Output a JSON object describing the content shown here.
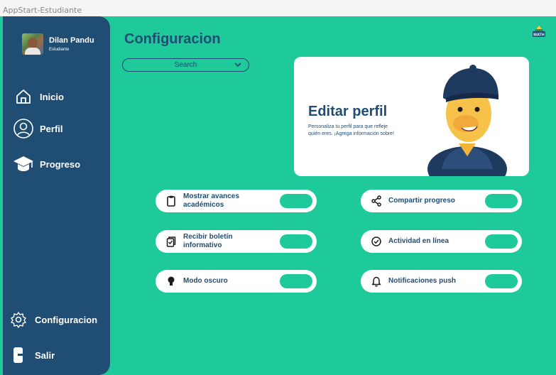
{
  "window": {
    "title": "AppStart-Estudiante"
  },
  "profile": {
    "name": "Dilan Pandu",
    "role": "Estudiante"
  },
  "sidebar": {
    "items": [
      {
        "label": "Inicio",
        "icon": "home-icon"
      },
      {
        "label": "Perfil",
        "icon": "user-icon"
      },
      {
        "label": "Progreso",
        "icon": "graduation-cap-icon"
      }
    ],
    "settings": {
      "label": "Configuracion",
      "icon": "gear-icon"
    },
    "logout": {
      "label": "Salir",
      "icon": "logout-icon"
    }
  },
  "main": {
    "title": "Configuracion",
    "search": {
      "placeholder": "Search"
    }
  },
  "hero": {
    "title": "Editar perfil",
    "description": "Personaliza tu perfil para que refleje quién eres. ¡Agrega información sobre!"
  },
  "settings": [
    {
      "label": "Mostrar avances académicos",
      "icon": "clipboard-icon",
      "enabled": true
    },
    {
      "label": "Compartir progreso",
      "icon": "share-icon",
      "enabled": true
    },
    {
      "label": "Recibir boletín informativo",
      "icon": "newsletter-icon",
      "enabled": true
    },
    {
      "label": "Actividad en línea",
      "icon": "check-circle-icon",
      "enabled": true
    },
    {
      "label": "Modo oscuro",
      "icon": "bulb-icon",
      "enabled": true
    },
    {
      "label": "Notificaciones push",
      "icon": "bell-icon",
      "enabled": true
    }
  ],
  "colors": {
    "accent": "#1ec99a",
    "primary": "#1f4d74",
    "card": "#ffffff"
  },
  "logo": {
    "text": "MATH"
  }
}
